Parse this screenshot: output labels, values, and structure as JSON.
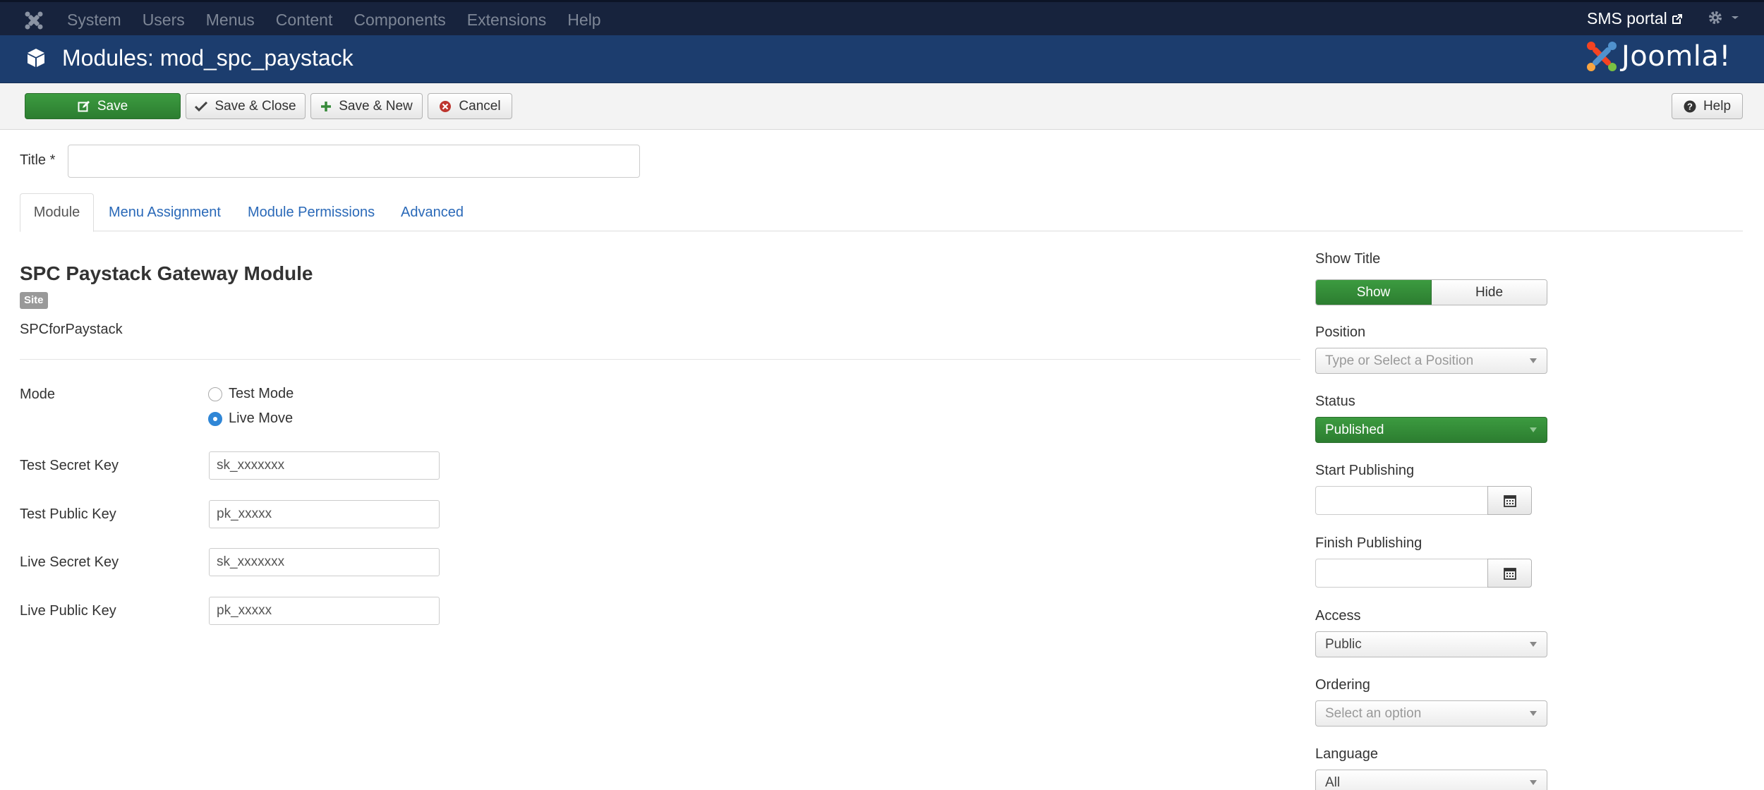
{
  "topnav": {
    "menu": [
      "System",
      "Users",
      "Menus",
      "Content",
      "Components",
      "Extensions",
      "Help"
    ],
    "site_link": "SMS portal"
  },
  "header": {
    "title": "Modules: mod_spc_paystack",
    "brand": "Joomla!"
  },
  "toolbar": {
    "save": "Save",
    "save_close": "Save & Close",
    "save_new": "Save & New",
    "cancel": "Cancel",
    "help": "Help"
  },
  "form": {
    "title_label": "Title *",
    "title_value": ""
  },
  "tabs": [
    "Module",
    "Menu Assignment",
    "Module Permissions",
    "Advanced"
  ],
  "module": {
    "heading": "SPC Paystack Gateway Module",
    "badge": "Site",
    "description": "SPCforPaystack",
    "mode_label": "Mode",
    "mode_options": [
      "Test Mode",
      "Live Move"
    ],
    "mode_selected": "Live Move",
    "fields": [
      {
        "label": "Test Secret Key",
        "value": "sk_xxxxxxx"
      },
      {
        "label": "Test Public Key",
        "value": "pk_xxxxx"
      },
      {
        "label": "Live Secret Key",
        "value": "sk_xxxxxxx"
      },
      {
        "label": "Live Public Key",
        "value": "pk_xxxxx"
      }
    ]
  },
  "sidebar": {
    "show_title": {
      "label": "Show Title",
      "options": [
        "Show",
        "Hide"
      ],
      "selected": "Show"
    },
    "position": {
      "label": "Position",
      "placeholder": "Type or Select a Position"
    },
    "status": {
      "label": "Status",
      "value": "Published"
    },
    "start_publishing": {
      "label": "Start Publishing",
      "value": ""
    },
    "finish_publishing": {
      "label": "Finish Publishing",
      "value": ""
    },
    "access": {
      "label": "Access",
      "value": "Public"
    },
    "ordering": {
      "label": "Ordering",
      "placeholder": "Select an option"
    },
    "language": {
      "label": "Language",
      "value": "All"
    }
  },
  "colors": {
    "topnav_bg": "#17233d",
    "header_bg": "#1c3d6e",
    "success_green": "#2f8a33",
    "link_blue": "#2a69b8",
    "radio_blue": "#2f86d6"
  }
}
